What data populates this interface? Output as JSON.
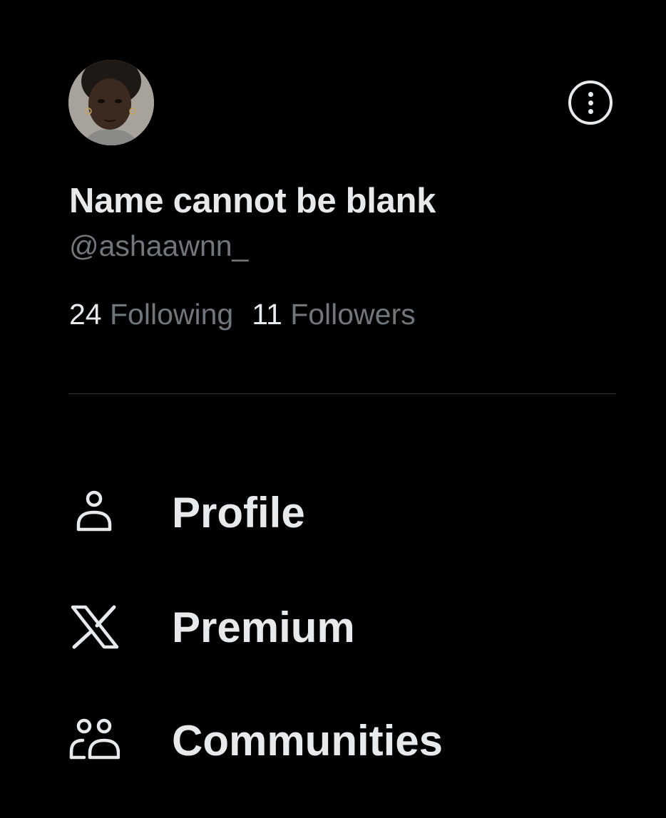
{
  "account": {
    "display_name": "Name cannot be blank",
    "handle": "@ashaawnn_"
  },
  "stats": {
    "following_count": "24",
    "following_label": "Following",
    "followers_count": "11",
    "followers_label": "Followers"
  },
  "menu": {
    "items": [
      {
        "label": "Profile",
        "icon": "person-icon"
      },
      {
        "label": "Premium",
        "icon": "x-logo-icon"
      },
      {
        "label": "Communities",
        "icon": "communities-icon"
      }
    ]
  },
  "colors": {
    "background": "#000000",
    "primary_text": "#e7e9ea",
    "secondary_text": "#71767b",
    "divider": "#2f3336"
  }
}
